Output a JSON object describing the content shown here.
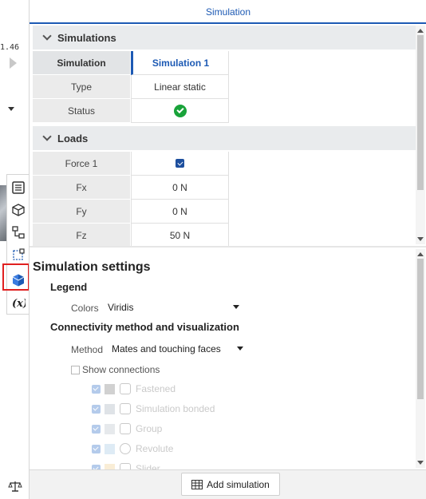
{
  "left_strip": {
    "readout": "1.46",
    "toolbar_icons": [
      "list-icon",
      "part-cube-icon",
      "assembly-tree-icon",
      "sketch-select-icon",
      "simulation-icon",
      "variable-function-icon"
    ],
    "bottom_icon": "scale-balance-icon"
  },
  "panel": {
    "title": "Simulation",
    "simulations_section": {
      "heading": "Simulations",
      "header_row": {
        "label": "Simulation",
        "value": "Simulation 1"
      },
      "rows": [
        {
          "label": "Type",
          "value": "Linear static"
        },
        {
          "label": "Status",
          "value": ""
        }
      ]
    },
    "loads_section": {
      "heading": "Loads",
      "rows": [
        {
          "label": "Force 1",
          "value": ""
        },
        {
          "label": "Fx",
          "value": "0 N"
        },
        {
          "label": "Fy",
          "value": "0 N"
        },
        {
          "label": "Fz",
          "value": "50 N"
        }
      ]
    },
    "settings": {
      "title": "Simulation settings",
      "legend_heading": "Legend",
      "colors_label": "Colors",
      "colors_value": "Viridis",
      "connectivity_heading": "Connectivity method and visualization",
      "method_label": "Method",
      "method_value": "Mates and touching faces",
      "show_connections_label": "Show connections",
      "connection_types": [
        {
          "label": "Fastened",
          "color": "#9a9a9a"
        },
        {
          "label": "Simulation bonded",
          "color": "#b9c3cc"
        },
        {
          "label": "Group",
          "color": "#c8cfd6"
        },
        {
          "label": "Revolute",
          "color": "#b7d3ea"
        },
        {
          "label": "Slider",
          "color": "#f2d9a6"
        }
      ]
    },
    "footer": {
      "add_button": "Add simulation"
    },
    "colors": {
      "accent": "#1d5ab4",
      "status_ok": "#19a33a"
    }
  }
}
